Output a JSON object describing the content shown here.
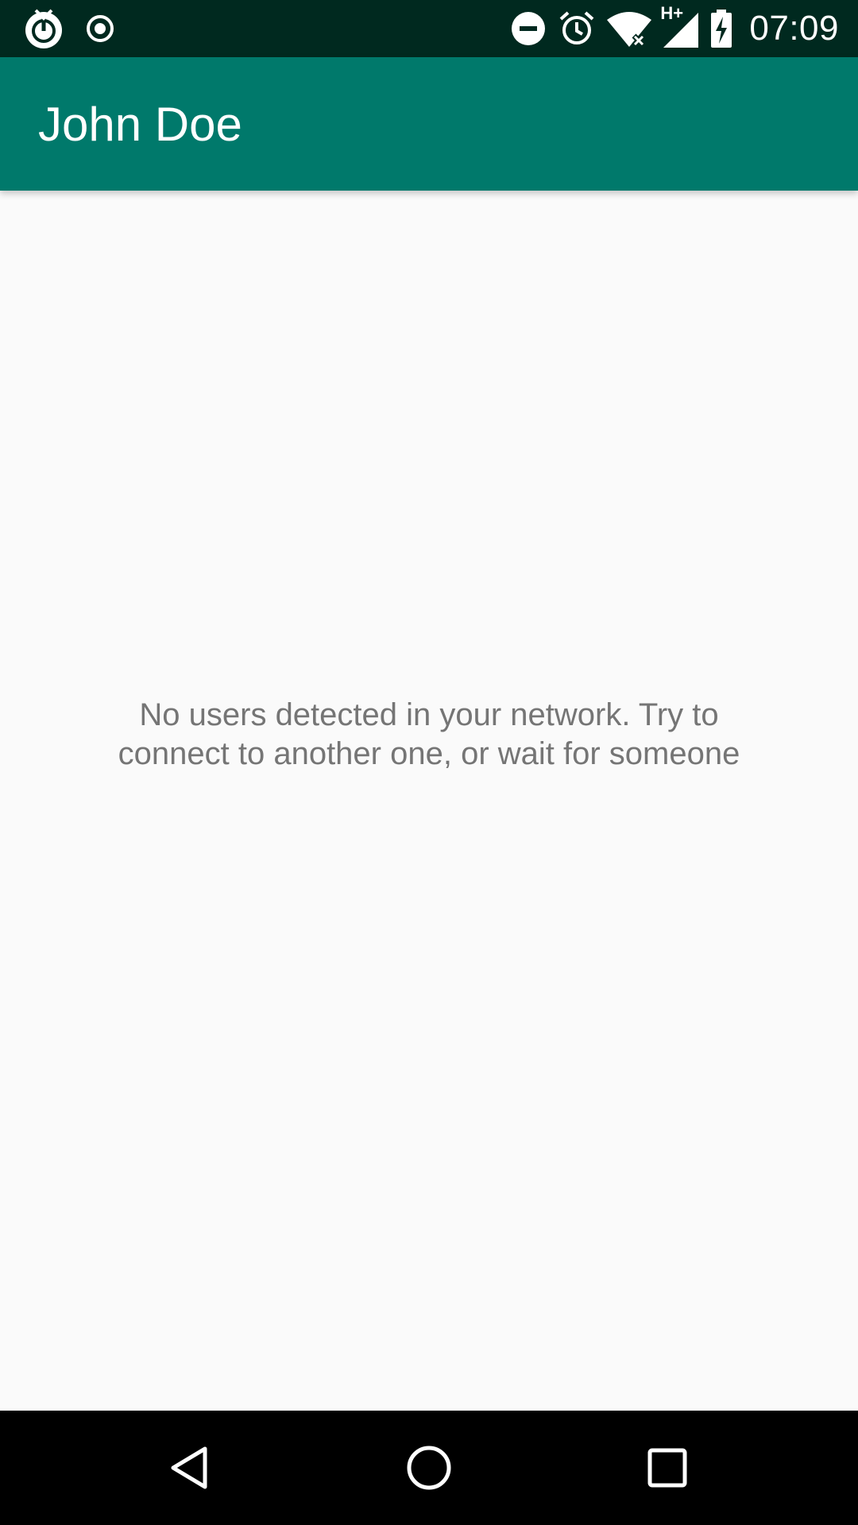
{
  "status_bar": {
    "time": "07:09",
    "left_icons": [
      "app-notification-icon",
      "record-icon"
    ],
    "right_icons": [
      "do-not-disturb-icon",
      "alarm-icon",
      "wifi-off-icon",
      "mobile-signal-icon",
      "battery-charging-icon"
    ],
    "network_type": "H+"
  },
  "app_bar": {
    "title": "John Doe"
  },
  "main": {
    "empty_message": "No users detected in your network. Try to connect to another one, or wait for someone"
  },
  "nav_bar": {
    "buttons": [
      "back",
      "home",
      "recents"
    ]
  },
  "colors": {
    "status_bar": "#00291f",
    "app_bar": "#00796b",
    "background": "#fafafa",
    "message_text": "#757575",
    "nav_bar": "#000000"
  }
}
